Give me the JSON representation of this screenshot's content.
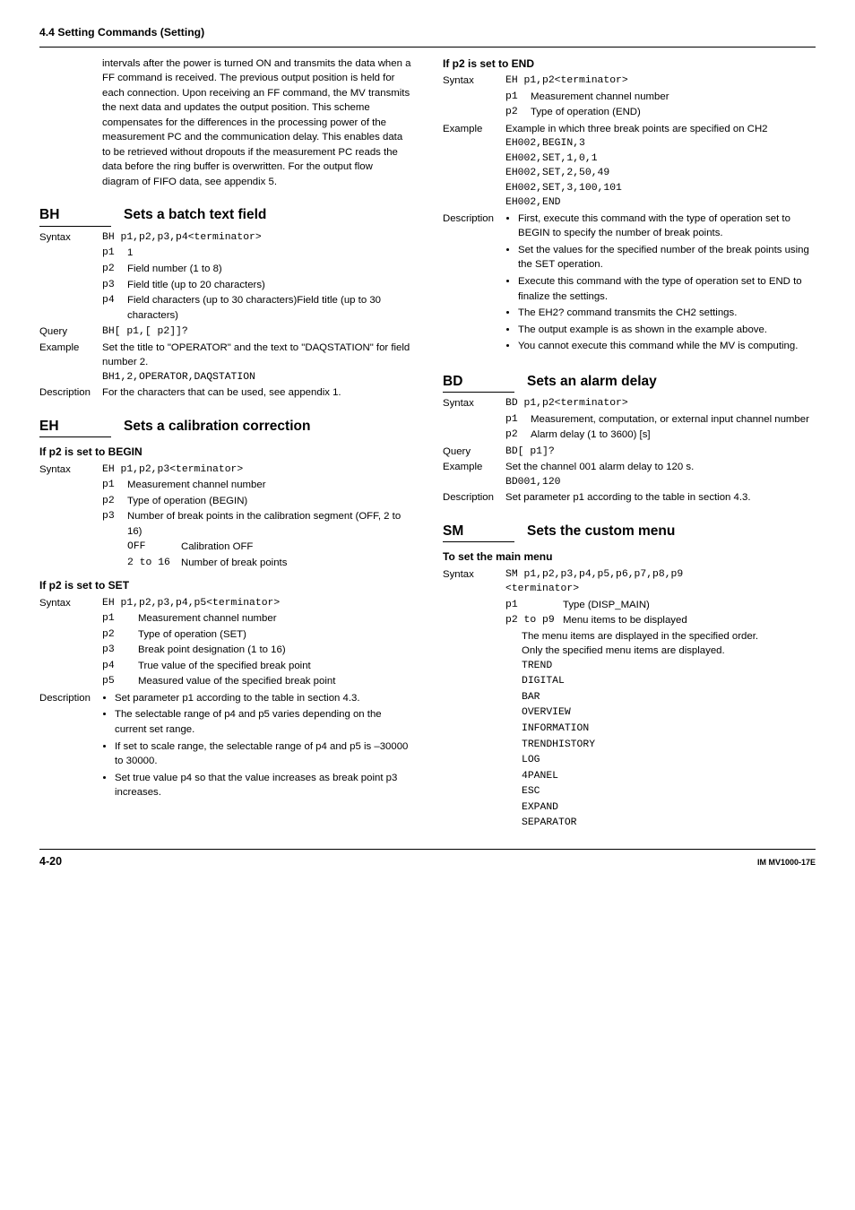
{
  "section_title": "4.4  Setting Commands (Setting)",
  "footer": {
    "page": "4-20",
    "doc_id": "IM MV1000-17E"
  },
  "intro_para": "intervals after the power is turned ON and transmits the data when a FF command is received. The previous output position is held for each connection. Upon receiving an FF command, the MV transmits the next data and updates the output position. This scheme compensates for the differences in the processing power of the measurement PC and the communication delay. This enables data to be retrieved without dropouts if the measurement PC reads the data before the ring buffer is overwritten. For the output flow diagram of FIFO data, see appendix 5.",
  "bh": {
    "code": "BH",
    "title": "Sets a batch text field",
    "syntax_label": "Syntax",
    "syntax": "BH p1,p2,p3,p4<terminator>",
    "p1": {
      "k": "p1",
      "v": "1"
    },
    "p2": {
      "k": "p2",
      "v": "Field number (1 to 8)"
    },
    "p3": {
      "k": "p3",
      "v": "Field title (up to 20 characters)"
    },
    "p4": {
      "k": "p4",
      "v": "Field characters (up to 30 characters)Field title (up to 30 characters)"
    },
    "query_label": "Query",
    "query": "BH[ p1,[ p2]]?",
    "example_label": "Example",
    "example_text": "Set the title to \"OPERATOR\" and the text to \"DAQSTATION\" for field number 2.",
    "example_cmd": "BH1,2,OPERATOR,DAQSTATION",
    "desc_label": "Description",
    "desc": "For the characters that can be used, see appendix 1."
  },
  "eh": {
    "code": "EH",
    "title": "Sets a calibration correction",
    "begin_heading": "If p2 is set to BEGIN",
    "begin_syntax": "EH p1,p2,p3<terminator>",
    "begin_p1": {
      "k": "p1",
      "v": "Measurement channel number"
    },
    "begin_p2": {
      "k": "p2",
      "v": "Type of operation (BEGIN)"
    },
    "begin_p3": {
      "k": "p3",
      "v": "Number of break points in the calibration segment (OFF, 2 to 16)"
    },
    "begin_off": {
      "k": "OFF",
      "v": "Calibration OFF"
    },
    "begin_range": {
      "k_a": "2",
      "to": " to ",
      "k_b": "16",
      "v": "Number of break points"
    },
    "set_heading": "If p2 is set to SET",
    "set_syntax": "EH p1,p2,p3,p4,p5<terminator>",
    "set_p1": {
      "k": "p1",
      "v": "Measurement channel number"
    },
    "set_p2": {
      "k": "p2",
      "v": "Type of operation (SET)"
    },
    "set_p3": {
      "k": "p3",
      "v": "Break point designation (1 to 16)"
    },
    "set_p4": {
      "k": "p4",
      "v": "True value of the specified break point"
    },
    "set_p5": {
      "k": "p5",
      "v": "Measured value of the specified break point"
    },
    "set_desc_label": "Description",
    "set_desc": [
      "Set parameter p1 according to the table in section 4.3.",
      "The selectable range of p4 and p5 varies depending on the current set range.",
      "If set to scale range, the selectable range of p4 and p5 is –30000 to 30000.",
      "Set true value p4 so that the value increases as break point p3 increases."
    ],
    "end_heading": "If p2 is set to END",
    "end_syntax": "EH p1,p2<terminator>",
    "end_p1": {
      "k": "p1",
      "v": "Measurement channel number"
    },
    "end_p2": {
      "k": "p2",
      "v": "Type of operation (END)"
    },
    "end_example_lead": "Example in which three break points are specified on CH2",
    "end_example_lines": [
      "EH002,BEGIN,3",
      "EH002,SET,1,0,1",
      "EH002,SET,2,50,49",
      "EH002,SET,3,100,101",
      "EH002,END"
    ],
    "end_desc": [
      "First, execute this command with the type of operation set to BEGIN to specify the number of break points.",
      "Set the values for the specified number of the break points using the SET operation.",
      "Execute this command with the type of operation set to END to finalize the settings.",
      "The EH2? command transmits the CH2 settings.",
      "The output example is as shown in the example above.",
      "You cannot execute this command while the MV is computing."
    ]
  },
  "bd": {
    "code": "BD",
    "title": "Sets an alarm delay",
    "syntax": "BD p1,p2<terminator>",
    "p1": {
      "k": "p1",
      "v": "Measurement, computation, or external input channel number"
    },
    "p2": {
      "k": "p2",
      "v": "Alarm delay (1 to 3600) [s]"
    },
    "query": "BD[ p1]?",
    "example_text": "Set the channel 001 alarm delay to 120 s.",
    "example_cmd": "BD001,120",
    "desc": "Set parameter p1 according to the table in section 4.3."
  },
  "sm": {
    "code": "SM",
    "title": "Sets the custom menu",
    "main_heading": "To set the main menu",
    "syntax_a": "SM p1,p2,p3,p4,p5,p6,p7,p8,p9",
    "syntax_b": "<terminator>",
    "p1": {
      "k": "p1",
      "v": "Type (DISP_MAIN)"
    },
    "p29_k_a": "p2",
    "p29_to": " to ",
    "p29_k_b": "p9",
    "p29_v": "Menu items to be displayed",
    "p29_note_a": "The menu items are displayed in the specified order.",
    "p29_note_b": "Only the specified menu items are displayed.",
    "menu_items": [
      "TREND",
      "DIGITAL",
      "BAR",
      "OVERVIEW",
      "INFORMATION",
      "TRENDHISTORY",
      "LOG",
      "4PANEL",
      "ESC",
      "EXPAND",
      "SEPARATOR"
    ]
  },
  "labels": {
    "syntax": "Syntax",
    "query": "Query",
    "example": "Example",
    "description": "Description"
  }
}
